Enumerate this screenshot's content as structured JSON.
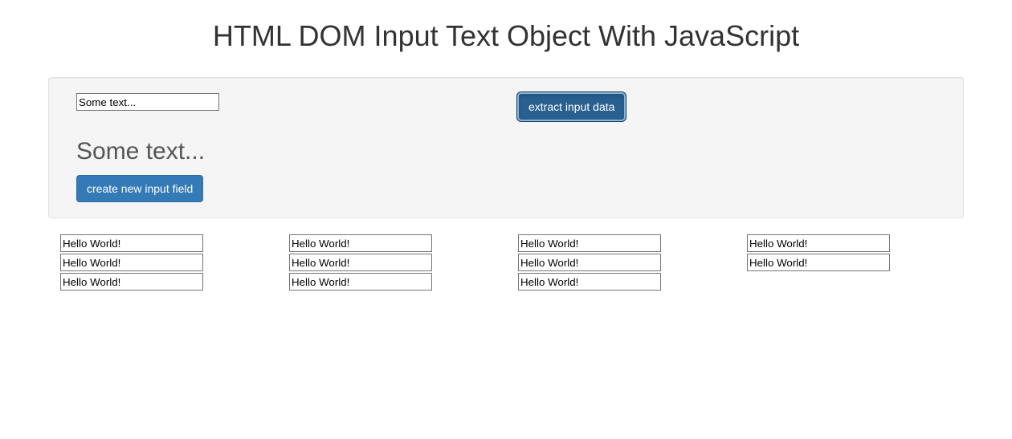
{
  "title": "HTML DOM Input Text Object With JavaScript",
  "panel": {
    "main_input_value": "Some text...",
    "extract_button_label": "extract input data",
    "extracted_text": "Some text...",
    "create_button_label": "create new input field"
  },
  "columns": [
    {
      "inputs": [
        "Hello World!",
        "Hello World!",
        "Hello World!"
      ]
    },
    {
      "inputs": [
        "Hello World!",
        "Hello World!",
        "Hello World!"
      ]
    },
    {
      "inputs": [
        "Hello World!",
        "Hello World!",
        "Hello World!"
      ]
    },
    {
      "inputs": [
        "Hello World!",
        "Hello World!"
      ]
    }
  ]
}
